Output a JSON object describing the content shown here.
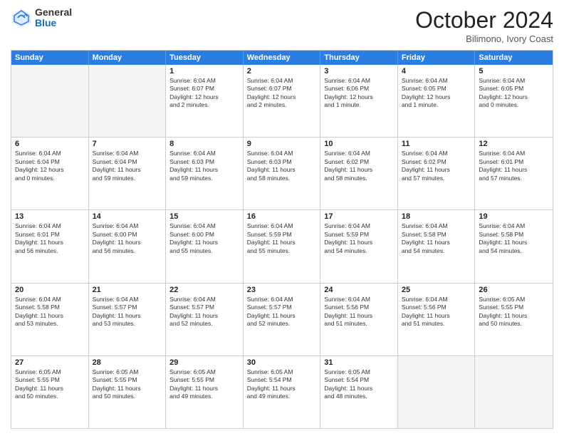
{
  "header": {
    "logo_general": "General",
    "logo_blue": "Blue",
    "month": "October 2024",
    "location": "Bilimono, Ivory Coast"
  },
  "weekdays": [
    "Sunday",
    "Monday",
    "Tuesday",
    "Wednesday",
    "Thursday",
    "Friday",
    "Saturday"
  ],
  "rows": [
    [
      {
        "day": "",
        "lines": [],
        "empty": true
      },
      {
        "day": "",
        "lines": [],
        "empty": true
      },
      {
        "day": "1",
        "lines": [
          "Sunrise: 6:04 AM",
          "Sunset: 6:07 PM",
          "Daylight: 12 hours",
          "and 2 minutes."
        ]
      },
      {
        "day": "2",
        "lines": [
          "Sunrise: 6:04 AM",
          "Sunset: 6:07 PM",
          "Daylight: 12 hours",
          "and 2 minutes."
        ]
      },
      {
        "day": "3",
        "lines": [
          "Sunrise: 6:04 AM",
          "Sunset: 6:06 PM",
          "Daylight: 12 hours",
          "and 1 minute."
        ]
      },
      {
        "day": "4",
        "lines": [
          "Sunrise: 6:04 AM",
          "Sunset: 6:05 PM",
          "Daylight: 12 hours",
          "and 1 minute."
        ]
      },
      {
        "day": "5",
        "lines": [
          "Sunrise: 6:04 AM",
          "Sunset: 6:05 PM",
          "Daylight: 12 hours",
          "and 0 minutes."
        ]
      }
    ],
    [
      {
        "day": "6",
        "lines": [
          "Sunrise: 6:04 AM",
          "Sunset: 6:04 PM",
          "Daylight: 12 hours",
          "and 0 minutes."
        ]
      },
      {
        "day": "7",
        "lines": [
          "Sunrise: 6:04 AM",
          "Sunset: 6:04 PM",
          "Daylight: 11 hours",
          "and 59 minutes."
        ]
      },
      {
        "day": "8",
        "lines": [
          "Sunrise: 6:04 AM",
          "Sunset: 6:03 PM",
          "Daylight: 11 hours",
          "and 59 minutes."
        ]
      },
      {
        "day": "9",
        "lines": [
          "Sunrise: 6:04 AM",
          "Sunset: 6:03 PM",
          "Daylight: 11 hours",
          "and 58 minutes."
        ]
      },
      {
        "day": "10",
        "lines": [
          "Sunrise: 6:04 AM",
          "Sunset: 6:02 PM",
          "Daylight: 11 hours",
          "and 58 minutes."
        ]
      },
      {
        "day": "11",
        "lines": [
          "Sunrise: 6:04 AM",
          "Sunset: 6:02 PM",
          "Daylight: 11 hours",
          "and 57 minutes."
        ]
      },
      {
        "day": "12",
        "lines": [
          "Sunrise: 6:04 AM",
          "Sunset: 6:01 PM",
          "Daylight: 11 hours",
          "and 57 minutes."
        ]
      }
    ],
    [
      {
        "day": "13",
        "lines": [
          "Sunrise: 6:04 AM",
          "Sunset: 6:01 PM",
          "Daylight: 11 hours",
          "and 56 minutes."
        ]
      },
      {
        "day": "14",
        "lines": [
          "Sunrise: 6:04 AM",
          "Sunset: 6:00 PM",
          "Daylight: 11 hours",
          "and 56 minutes."
        ]
      },
      {
        "day": "15",
        "lines": [
          "Sunrise: 6:04 AM",
          "Sunset: 6:00 PM",
          "Daylight: 11 hours",
          "and 55 minutes."
        ]
      },
      {
        "day": "16",
        "lines": [
          "Sunrise: 6:04 AM",
          "Sunset: 5:59 PM",
          "Daylight: 11 hours",
          "and 55 minutes."
        ]
      },
      {
        "day": "17",
        "lines": [
          "Sunrise: 6:04 AM",
          "Sunset: 5:59 PM",
          "Daylight: 11 hours",
          "and 54 minutes."
        ]
      },
      {
        "day": "18",
        "lines": [
          "Sunrise: 6:04 AM",
          "Sunset: 5:58 PM",
          "Daylight: 11 hours",
          "and 54 minutes."
        ]
      },
      {
        "day": "19",
        "lines": [
          "Sunrise: 6:04 AM",
          "Sunset: 5:58 PM",
          "Daylight: 11 hours",
          "and 54 minutes."
        ]
      }
    ],
    [
      {
        "day": "20",
        "lines": [
          "Sunrise: 6:04 AM",
          "Sunset: 5:58 PM",
          "Daylight: 11 hours",
          "and 53 minutes."
        ]
      },
      {
        "day": "21",
        "lines": [
          "Sunrise: 6:04 AM",
          "Sunset: 5:57 PM",
          "Daylight: 11 hours",
          "and 53 minutes."
        ]
      },
      {
        "day": "22",
        "lines": [
          "Sunrise: 6:04 AM",
          "Sunset: 5:57 PM",
          "Daylight: 11 hours",
          "and 52 minutes."
        ]
      },
      {
        "day": "23",
        "lines": [
          "Sunrise: 6:04 AM",
          "Sunset: 5:57 PM",
          "Daylight: 11 hours",
          "and 52 minutes."
        ]
      },
      {
        "day": "24",
        "lines": [
          "Sunrise: 6:04 AM",
          "Sunset: 5:56 PM",
          "Daylight: 11 hours",
          "and 51 minutes."
        ]
      },
      {
        "day": "25",
        "lines": [
          "Sunrise: 6:04 AM",
          "Sunset: 5:56 PM",
          "Daylight: 11 hours",
          "and 51 minutes."
        ]
      },
      {
        "day": "26",
        "lines": [
          "Sunrise: 6:05 AM",
          "Sunset: 5:55 PM",
          "Daylight: 11 hours",
          "and 50 minutes."
        ]
      }
    ],
    [
      {
        "day": "27",
        "lines": [
          "Sunrise: 6:05 AM",
          "Sunset: 5:55 PM",
          "Daylight: 11 hours",
          "and 50 minutes."
        ]
      },
      {
        "day": "28",
        "lines": [
          "Sunrise: 6:05 AM",
          "Sunset: 5:55 PM",
          "Daylight: 11 hours",
          "and 50 minutes."
        ]
      },
      {
        "day": "29",
        "lines": [
          "Sunrise: 6:05 AM",
          "Sunset: 5:55 PM",
          "Daylight: 11 hours",
          "and 49 minutes."
        ]
      },
      {
        "day": "30",
        "lines": [
          "Sunrise: 6:05 AM",
          "Sunset: 5:54 PM",
          "Daylight: 11 hours",
          "and 49 minutes."
        ]
      },
      {
        "day": "31",
        "lines": [
          "Sunrise: 6:05 AM",
          "Sunset: 5:54 PM",
          "Daylight: 11 hours",
          "and 48 minutes."
        ]
      },
      {
        "day": "",
        "lines": [],
        "empty": true
      },
      {
        "day": "",
        "lines": [],
        "empty": true
      }
    ]
  ]
}
